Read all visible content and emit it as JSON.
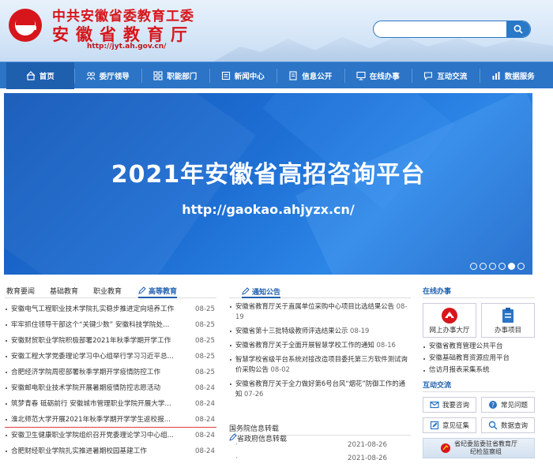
{
  "header": {
    "title_line1": "中共安徽省委教育工委",
    "title_line2": "安徽省教育厅",
    "url": "http://jyt.ah.gov.cn/",
    "search_placeholder": ""
  },
  "nav": [
    {
      "label": "首页",
      "icon": "home-icon",
      "active": true
    },
    {
      "label": "委厅领导",
      "icon": "people-icon"
    },
    {
      "label": "职能部门",
      "icon": "grid-icon"
    },
    {
      "label": "新闻中心",
      "icon": "news-icon"
    },
    {
      "label": "信息公开",
      "icon": "doc-icon"
    },
    {
      "label": "在线办事",
      "icon": "monitor-icon"
    },
    {
      "label": "互动交流",
      "icon": "chat-icon"
    },
    {
      "label": "数据服务",
      "icon": "data-icon"
    }
  ],
  "banner": {
    "title": "2021年安徽省高招咨询平台",
    "url": "http://gaokao.ahjyzx.cn/",
    "dots": 6,
    "active_dot": 5
  },
  "left": {
    "tabs": [
      "教育要闻",
      "基础教育",
      "职业教育",
      "高等教育"
    ],
    "active_tab": 3,
    "items": [
      {
        "title": "安徽电气工程职业技术学院扎实稳步推进定向培养工作",
        "date": "08-25"
      },
      {
        "title": "牢牢抓住领导干部这个“关键少数” 安徽科技学院处...",
        "date": "08-25"
      },
      {
        "title": "安徽财贸职业学院积极部署2021年秋季学期开学工作",
        "date": "08-25"
      },
      {
        "title": "安徽工程大学党委理论学习中心组举行学习习近平总...",
        "date": "08-25"
      },
      {
        "title": "合肥经济学院周密部署秋季学期开学疫情防控工作",
        "date": "08-25"
      },
      {
        "title": "安徽邮电职业技术学院开展暑期疫情防控志愿活动",
        "date": "08-24"
      },
      {
        "title": "筑梦青春 砥砺前行 安徽城市管理职业学院开展大学...",
        "date": "08-24"
      },
      {
        "title": "淮北师范大学开展2021年秋季学期开学学生返校报...",
        "date": "08-24"
      },
      {
        "title": "安徽卫生健康职业学院组织召开党委理论学习中心组...",
        "date": "08-24"
      },
      {
        "title": "合肥财经职业学院扎实推进暑期校园基建工作",
        "date": "08-24"
      }
    ]
  },
  "middle": {
    "notice_tab": "通知公告",
    "notices": [
      {
        "title": "安徽省教育厅关于直属单位采购中心项目比选结果公告",
        "date": "08-19"
      },
      {
        "title": "安徽省第十三批特级教师评选结果公示",
        "date": "08-19"
      },
      {
        "title": "安徽省教育厅关于全面开展智慧学校工作的通知",
        "date": "08-16"
      },
      {
        "title": "智慧学校省级平台系统对接改造项目委托第三方软件测试询价采购公告",
        "date": "08-02"
      },
      {
        "title": "安徽省教育厅关于全力做好第6号台风“烟花”防御工作的通知",
        "date": "07-26"
      }
    ],
    "tabs2": [
      "国务院信息转载",
      "省政府信息转载"
    ],
    "active_tab2": 1,
    "gov_items": [
      {
        "title": "·",
        "date": "2021-08-26"
      },
      {
        "title": "·",
        "date": "2021-08-26"
      }
    ]
  },
  "right": {
    "online_title": "在线办事",
    "services": [
      {
        "label": "网上办事大厅",
        "icon": "hall-logo-icon"
      },
      {
        "label": "办事项目",
        "icon": "clipboard-icon"
      }
    ],
    "links": [
      "安徽省教育管理公共平台",
      "安徽基础教育资源应用平台",
      "信访月报表采集系统"
    ],
    "interact_title": "互动交流",
    "interact": [
      {
        "label": "我要咨询",
        "icon": "mail-icon"
      },
      {
        "label": "常见问题",
        "icon": "question-icon"
      },
      {
        "label": "意见征集",
        "icon": "edit-icon"
      },
      {
        "label": "数据查询",
        "icon": "search-icon"
      }
    ],
    "discipline_line1": "省纪委监委驻省教育厅",
    "discipline_line2": "纪检监察组"
  }
}
